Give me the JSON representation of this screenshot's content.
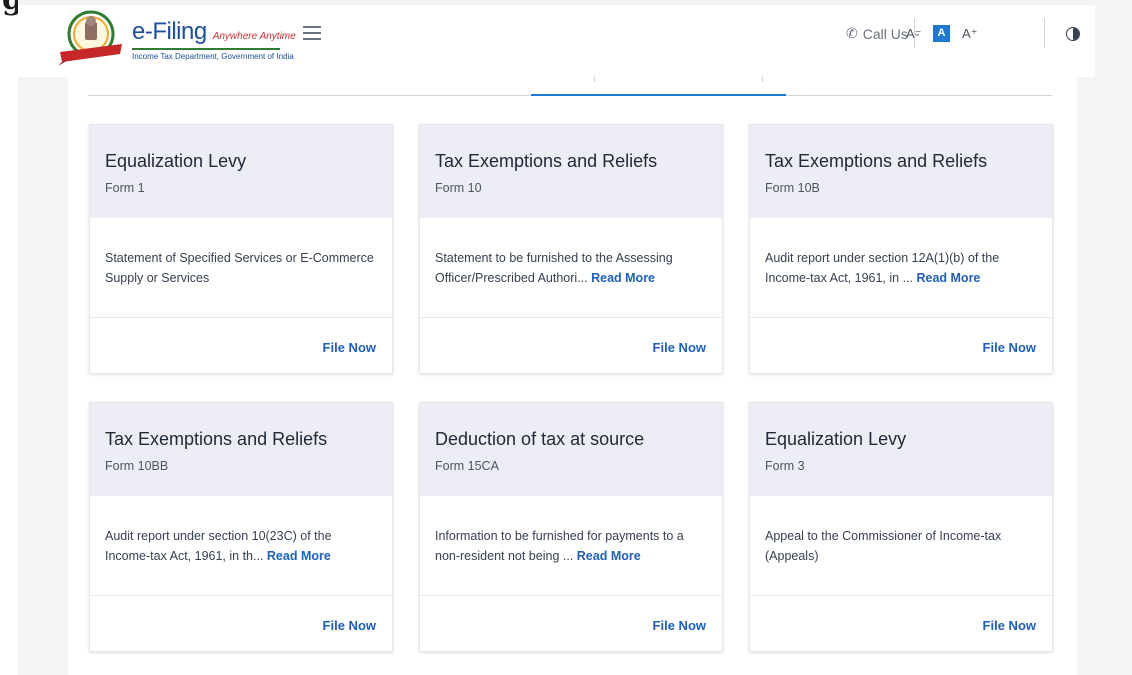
{
  "header": {
    "logo_title": "e-Filing",
    "logo_tagline": "Anywhere Anytime",
    "logo_subtitle": "Income Tax Department, Government of India",
    "call_us": "Call Us",
    "font_decrease": "A⁻",
    "font_default": "A",
    "font_increase": "A⁺",
    "icons": [
      "emblem-logo",
      "hamburger-menu-icon",
      "phone-icon",
      "chevron-down-icon",
      "contrast-icon"
    ]
  },
  "colors": {
    "accent": "#1f78d1",
    "link": "#1f5fbf",
    "card_header_bg": "#ededf5"
  },
  "cards": [
    {
      "title": "Equalization Levy",
      "form": "Form 1",
      "desc": "Statement of Specified Services or E-Commerce Supply or Services",
      "read_more": "",
      "action": "File Now"
    },
    {
      "title": "Tax Exemptions and Reliefs",
      "form": "Form 10",
      "desc": "Statement to be furnished to the Assessing Officer/Prescribed Authori...",
      "read_more": "Read More",
      "action": "File Now"
    },
    {
      "title": "Tax Exemptions and Reliefs",
      "form": "Form 10B",
      "desc": "Audit report under section 12A(1)(b) of the Income-tax Act, 1961, in ...",
      "read_more": "Read More",
      "action": "File Now"
    },
    {
      "title": "Tax Exemptions and Reliefs",
      "form": "Form 10BB",
      "desc": "Audit report under section 10(23C) of the Income-tax Act, 1961, in th...",
      "read_more": "Read More",
      "action": "File Now"
    },
    {
      "title": "Deduction of tax at source",
      "form": "Form 15CA",
      "desc": "Information to be furnished for payments to a non-resident not being ...",
      "read_more": "Read More",
      "action": "File Now"
    },
    {
      "title": "Equalization Levy",
      "form": "Form 3",
      "desc": "Appeal to the Commissioner of Income-tax (Appeals)",
      "read_more": "",
      "action": "File Now"
    }
  ]
}
